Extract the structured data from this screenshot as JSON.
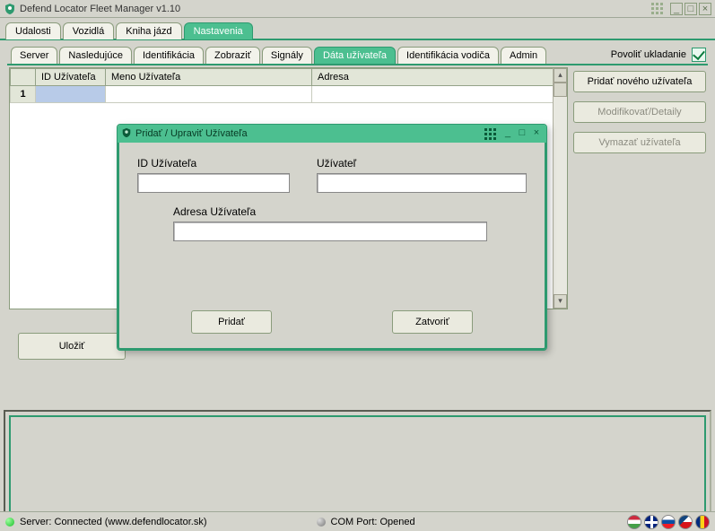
{
  "app": {
    "title": "Defend Locator Fleet Manager v1.10"
  },
  "mainTabs": {
    "items": [
      {
        "label": "Udalosti"
      },
      {
        "label": "Vozidlá"
      },
      {
        "label": "Kniha jázd"
      },
      {
        "label": "Nastavenia"
      }
    ],
    "activeIndex": 3
  },
  "subTabs": {
    "items": [
      {
        "label": "Server"
      },
      {
        "label": "Nasledujúce"
      },
      {
        "label": "Identifikácia"
      },
      {
        "label": "Zobraziť"
      },
      {
        "label": "Signály"
      },
      {
        "label": "Dáta užívateľa"
      },
      {
        "label": "Identifikácia vodiča"
      },
      {
        "label": "Admin"
      }
    ],
    "activeIndex": 5
  },
  "allowSave": {
    "label": "Povoliť ukladanie",
    "checked": true
  },
  "table": {
    "columns": [
      {
        "header": "ID Užívateľa"
      },
      {
        "header": "Meno Užívateľa"
      },
      {
        "header": "Adresa"
      }
    ],
    "rows": [
      {
        "n": "1",
        "id": "",
        "name": "",
        "addr": ""
      }
    ]
  },
  "sidebar": {
    "addUser": "Pridať nového užívateľa",
    "modify": "Modifikovať/Detaily",
    "deleteUser": "Vymazať užívateľa"
  },
  "save": {
    "label": "Uložiť"
  },
  "dialog": {
    "title": "Pridať / Upraviť Užívateľa",
    "idLabel": "ID Užívateľa",
    "userLabel": "Užívateľ",
    "addrLabel": "Adresa Užívateľa",
    "idValue": "",
    "userValue": "",
    "addrValue": "",
    "addBtn": "Pridať",
    "closeBtn": "Zatvoriť"
  },
  "status": {
    "server": "Server: Connected (www.defendlocator.sk)",
    "com": "COM Port: Opened"
  }
}
